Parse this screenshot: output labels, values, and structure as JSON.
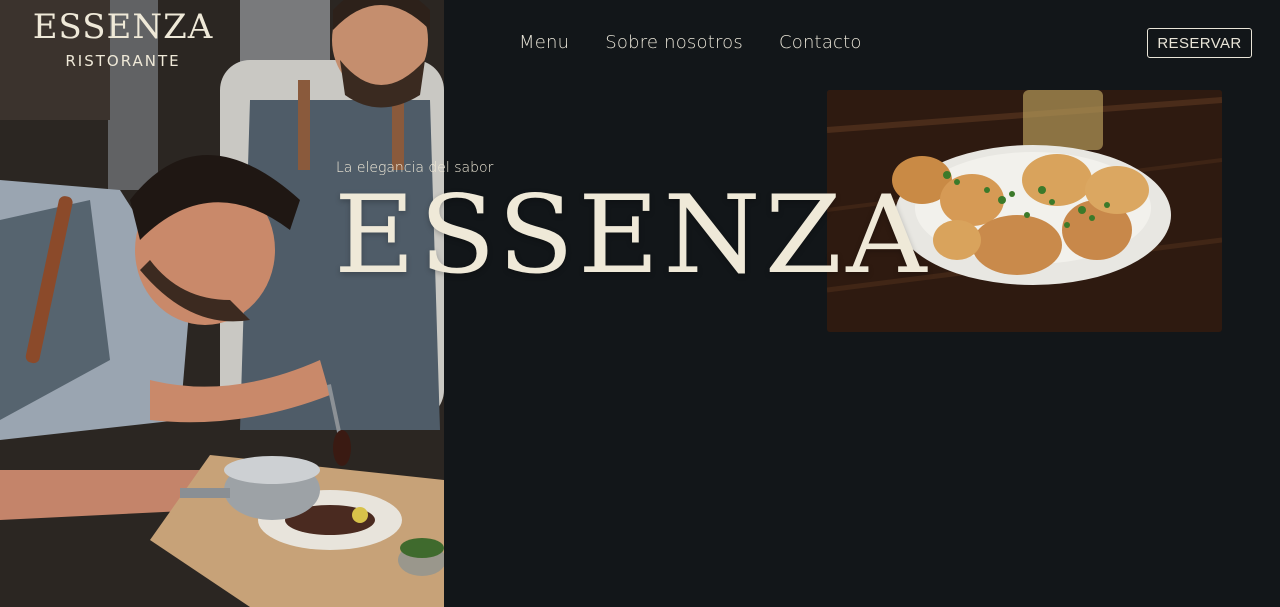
{
  "brand": {
    "name": "ESSENZA",
    "sub": "RISTORANTE"
  },
  "nav": {
    "items": [
      {
        "label": "Menu"
      },
      {
        "label": "Sobre nosotros"
      },
      {
        "label": "Contacto"
      }
    ],
    "cta_label": "RESERVAR"
  },
  "hero": {
    "tagline": "La elegancia del sabor",
    "title": "ESSENZA"
  },
  "colors": {
    "background": "#121619",
    "text": "#efe9d8"
  }
}
